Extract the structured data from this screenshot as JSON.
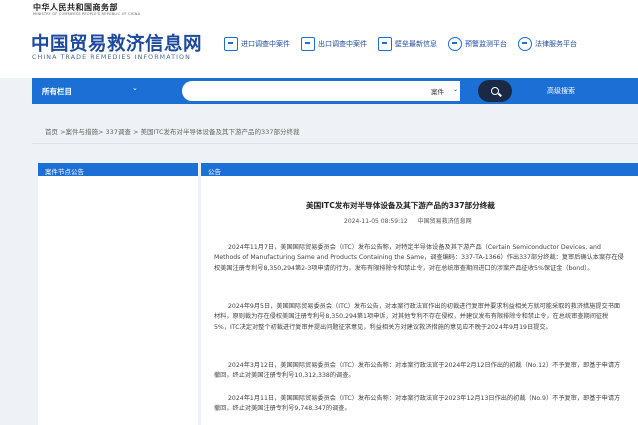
{
  "header": {
    "ministry_cn": "中华人民共和国商务部",
    "ministry_en": "MINISTRY OF COMMERCE PEOPLE'S REPUBLIC OF CHINA",
    "logo_cn": "中国贸易救济信息网",
    "logo_en": "CHINA TRADE REMEDIES INFORMATION",
    "links": [
      {
        "label": "进口调查中案件",
        "icon": "import-case-icon"
      },
      {
        "label": "出口调查中案件",
        "icon": "export-case-icon"
      },
      {
        "label": "壁垒最新信息",
        "icon": "barrier-info-icon"
      },
      {
        "label": "预警监测平台",
        "icon": "warning-monitor-icon"
      },
      {
        "label": "法律服务平台",
        "icon": "legal-service-icon"
      }
    ]
  },
  "navbar": {
    "all_columns": "所有栏目",
    "search_placeholder": "",
    "category": "案件",
    "advanced_search": "高级搜索",
    "colors": {
      "bar": "#1c6fd4",
      "search_button": "#1a2a45"
    }
  },
  "breadcrumb": {
    "text": "首页 >案件与措施> 337调查 > 美国ITC发布对半导体设备及其下游产品的337部分终裁"
  },
  "left_panel": {
    "title": "案件节点公告"
  },
  "article": {
    "tag": "公告",
    "title": "美国ITC发布对半导体设备及其下游产品的337部分终裁",
    "date": "2024-11-05 08:59:12",
    "source": "中国贸易救济信息网",
    "paragraphs": [
      "2024年11月7日，美国国际贸易委员会（ITC）发布公告称，对特定半导体设备及其下游产品（Certain Semiconductor Devices, and Methods of Manufacturing Same and Products Containing the Same，调查编码：337-TA-1366）作出337部分终裁：复审后确认本案存在侵权美国注册专利号8,350,294第2-3项申请的行为，发布有限排除令和禁止令，对在总统审查期间进口的涉案产品征收5%保证金（bond）。",
      "2024年9月5日，美国国际贸易委员会（ITC）发布公告，对本案行政法官作出的初裁进行复审并要求利益相关方就可能采取的救济措施提交书面材料，原则裁为存在侵权美国注册专利号8,350,294第1项申诉，对其他专利不存在侵权，并建议发布有限排除令和禁止令，在总统审查期间征税5%，ITC决定对整个初裁进行复审并提出问题征求意见，利益相关方对建议救济措施的意见应不晚于2024年9月19日提交。",
      "2024年3月12日，美国国际贸易委员会（ITC）发布公告称：对本案行政法官于2024年2月12日作出的初裁（No.12）不予复审，即基于申请方撤回，终止对美国注册专利号10,312,338的调查。",
      "2024年1月11日，美国国际贸易委员会（ITC）发布公告称：对本案行政法官于2023年12月13日作出的初裁（No.9）不予复审，即基于申请方撤回，终止对美国注册专利号9,748,347的调查。"
    ]
  }
}
